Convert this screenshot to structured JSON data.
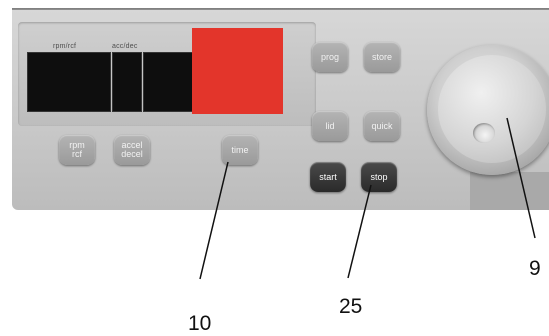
{
  "display": {
    "lcd_left_label": "rpm/rcf",
    "lcd_right_label": "acc/dec"
  },
  "buttons": {
    "prog": "prog",
    "store": "store",
    "lid": "lid",
    "quick": "quick",
    "start": "start",
    "stop": "stop",
    "time": "time",
    "rpm_rcf": [
      "rpm",
      "rcf"
    ],
    "accel_decel": [
      "accel",
      "decel"
    ]
  },
  "callouts": {
    "time_button": "10",
    "stop_button": "25",
    "control_knob": "9"
  },
  "colors": {
    "red_display": "#e3352b",
    "panel": "#cccccc",
    "dark_button": "#333333"
  }
}
